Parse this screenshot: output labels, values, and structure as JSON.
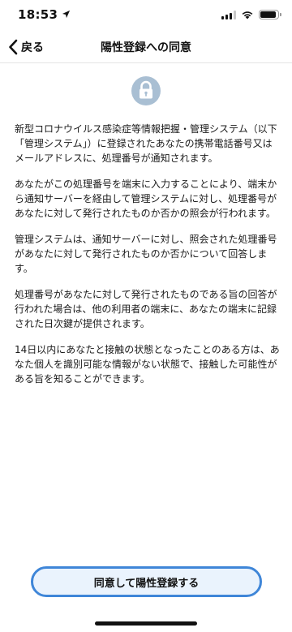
{
  "status_bar": {
    "time": "18:53",
    "signal_bars": 4,
    "signal_active": 3,
    "battery_level": 0.9
  },
  "nav": {
    "back_label": "戻る",
    "title": "陽性登録への同意"
  },
  "icons": {
    "back": "chevron-left-icon",
    "lock": "lock-icon"
  },
  "colors": {
    "accent": "#3f86d8",
    "button_fill": "#eaf3fd",
    "lock_circle": "#a9bfd3"
  },
  "body": {
    "paragraphs": [
      "新型コロナウイルス感染症等情報把握・管理システム（以下「管理システム」）に登録されたあなたの携帯電話番号又はメールアドレスに、処理番号が通知されます。",
      "あなたがこの処理番号を端末に入力することにより、端末から通知サーバーを経由して管理システムに対し、処理番号があなたに対して発行されたものか否かの照会が行われます。",
      "管理システムは、通知サーバーに対し、照会された処理番号があなたに対して発行されたものか否かについて回答します。",
      "処理番号があなたに対して発行されたものである旨の回答が行われた場合は、他の利用者の端末に、あなたの端末に記録された日次鍵が提供されます。",
      "14日以内にあなたと接触の状態となったことのある方は、あなた個人を識別可能な情報がない状態で、接触した可能性がある旨を知ることができます。"
    ]
  },
  "footer": {
    "agree_button": "同意して陽性登録する"
  }
}
